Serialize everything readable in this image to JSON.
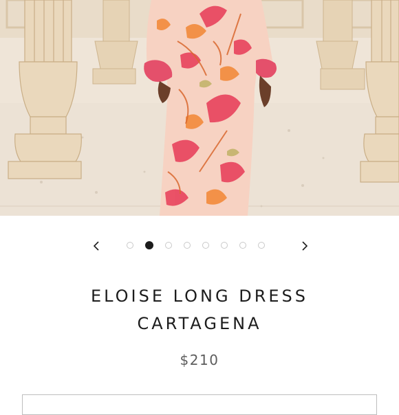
{
  "product": {
    "title_line1": "ELOISE LONG DRESS",
    "title_line2": "CARTAGENA",
    "price": "$210"
  },
  "gallery": {
    "image_count": 8,
    "active_index": 1
  },
  "colors": {
    "text": "#1c1c1c",
    "price": "#5c5c5c",
    "dot_inactive_border": "#c9c9c9",
    "dot_active": "#1c1c1c"
  },
  "icons": {
    "prev": "chevron-left-icon",
    "next": "chevron-right-icon"
  }
}
